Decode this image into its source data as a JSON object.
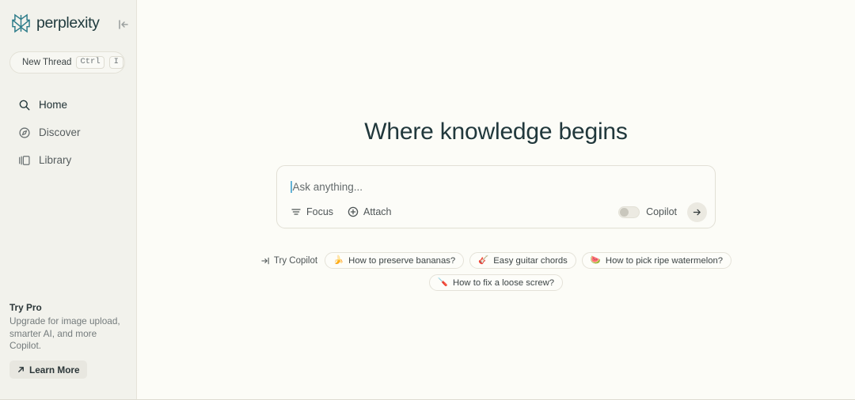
{
  "brand": {
    "name": "perplexity",
    "logo_icon": "perplexity-asterisk-logo",
    "logo_color": "#2a7a88",
    "collapse_icon": "collapse-sidebar-icon"
  },
  "sidebar": {
    "new_thread": {
      "label": "New Thread",
      "shortcut_modifier": "Ctrl",
      "shortcut_key": "I"
    },
    "items": [
      {
        "label": "Home",
        "icon": "search-icon",
        "active": true
      },
      {
        "label": "Discover",
        "icon": "compass-icon",
        "active": false
      },
      {
        "label": "Library",
        "icon": "library-books-icon",
        "active": false
      }
    ],
    "promo": {
      "title": "Try Pro",
      "text": "Upgrade for image upload, smarter AI, and more Copilot.",
      "button_label": "Learn More",
      "button_icon": "arrow-up-right-icon"
    }
  },
  "main": {
    "headline": "Where knowledge begins",
    "ask": {
      "placeholder": "Ask anything...",
      "value": "",
      "focus_label": "Focus",
      "focus_icon": "filter-icon",
      "attach_label": "Attach",
      "attach_icon": "plus-circle-icon",
      "copilot_label": "Copilot",
      "copilot_enabled": false,
      "submit_icon": "arrow-right-icon"
    },
    "suggestions": {
      "try_copilot_label": "Try Copilot",
      "try_copilot_icon": "arrow-right-circle-icon",
      "row1": [
        {
          "emoji": "🍌",
          "label": "How to preserve bananas?"
        },
        {
          "emoji": "🎸",
          "label": "Easy guitar chords"
        },
        {
          "emoji": "🍉",
          "label": "How to pick ripe watermelon?"
        }
      ],
      "row2": [
        {
          "emoji": "🪛",
          "label": "How to fix a loose screw?"
        }
      ]
    }
  },
  "colors": {
    "sidebar_bg": "#f2f2ec",
    "main_bg": "#fcfcf7",
    "brand_teal": "#2a7a88",
    "heading": "#21383c",
    "caret": "#63b3d6"
  }
}
